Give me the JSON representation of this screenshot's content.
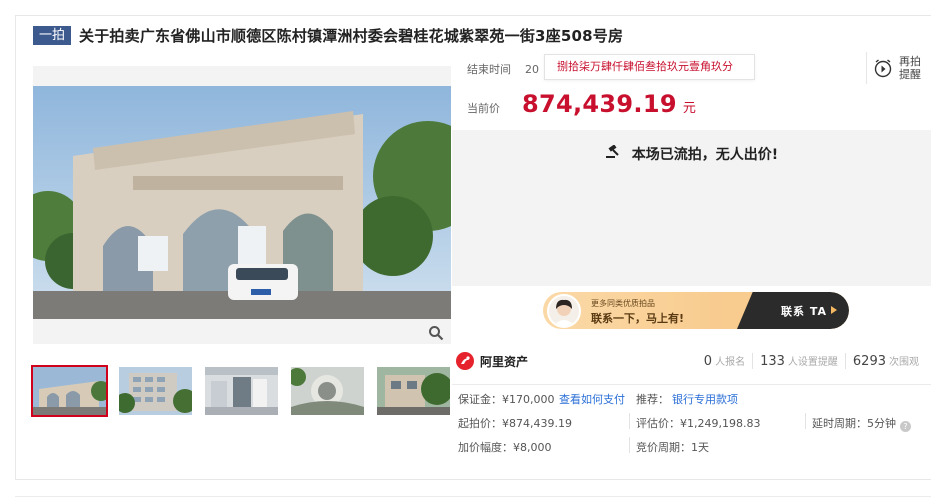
{
  "title": {
    "round_tag": "一拍",
    "text": "关于拍卖广东省佛山市顺德区陈村镇潭洲村委会碧桂花城紫翠苑一街3座508号房"
  },
  "auction": {
    "end_time_label": "结束时间",
    "end_time_value": "20",
    "price_tooltip": "捌拾柒万肆仟肆佰叁拾玖元壹角玖分",
    "remind_line1": "再拍",
    "remind_line2": "提醒",
    "current_price_label": "当前价",
    "current_price_value": "874,439.19",
    "current_price_unit": "元",
    "status_message": "本场已流拍，无人出价!"
  },
  "contact_banner": {
    "line1": "更多同类优质拍品",
    "line2": "联系一下，马上有!",
    "cta": "联系 TA"
  },
  "platform": {
    "brand": "阿里资产",
    "stats": [
      {
        "number": "0",
        "label": "人报名"
      },
      {
        "number": "133",
        "label": "人设置提醒"
      },
      {
        "number": "6293",
        "label": "次围观"
      }
    ]
  },
  "details": {
    "deposit": "保证金：¥170,000",
    "how_to_pay": "查看如何支付",
    "recommend_label": "推荐：",
    "recommend_link": "银行专用款项",
    "start_price": "起拍价：¥874,439.19",
    "valuation": "评估价：¥1,249,198.83",
    "delay_period": "延时周期：5分钟",
    "increment": "加价幅度：¥8,000",
    "bid_period": "竞价周期：1天"
  },
  "gallery": {
    "thumbnail_count": 5,
    "active_index": 0
  }
}
